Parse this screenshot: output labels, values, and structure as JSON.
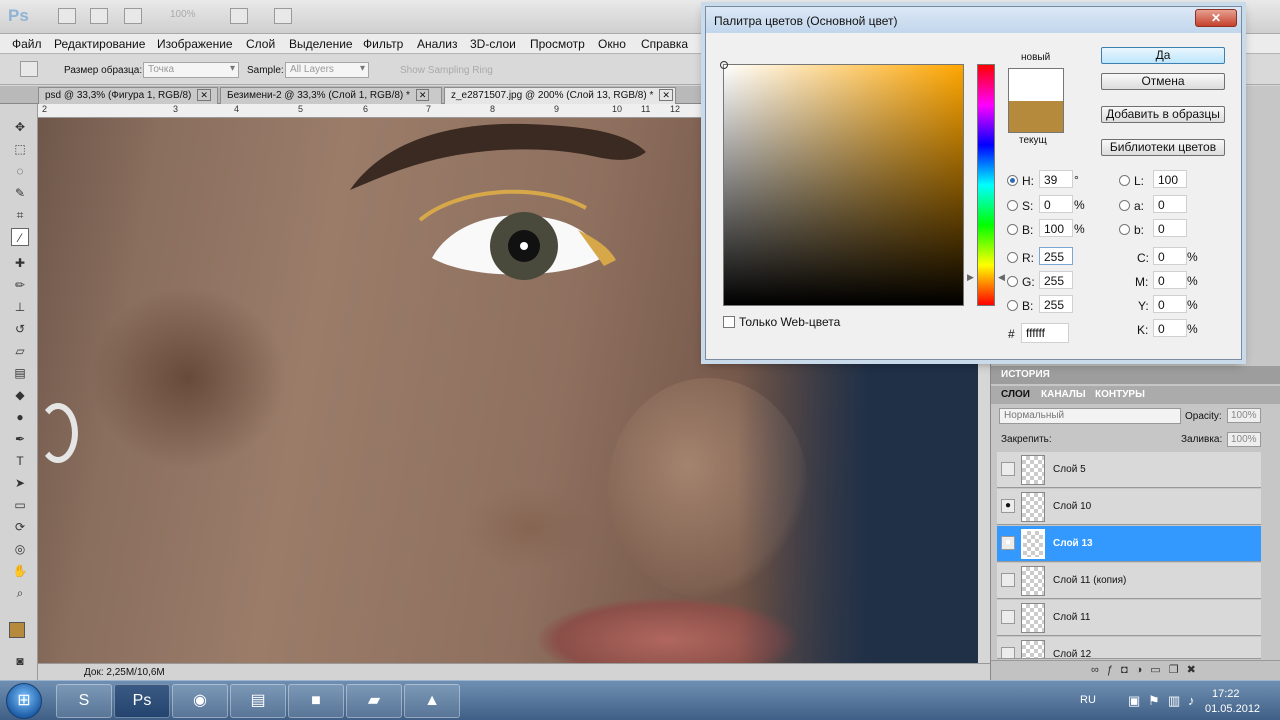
{
  "app": {
    "logo": "Ps",
    "zoom": "100%"
  },
  "menu": [
    "Файл",
    "Редактирование",
    "Изображение",
    "Слой",
    "Выделение",
    "Фильтр",
    "Анализ",
    "3D-слои",
    "Просмотр",
    "Окно",
    "Справка"
  ],
  "options": {
    "sample_size_label": "Размер образца:",
    "sample_size_value": "Точка",
    "sample_label": "Sample:",
    "sample_value": "All Layers",
    "sampling_ring_label": "Show Sampling Ring"
  },
  "doc_tabs": [
    {
      "label": "psd @ 33,3% (Фигура 1, RGB/8)"
    },
    {
      "label": "Безимени-2 @ 33,3% (Слой 1, RGB/8) *"
    },
    {
      "label": "z_e2871507.jpg @ 200% (Слой 13, RGB/8) *"
    }
  ],
  "ruler": [
    "2",
    "3",
    "4",
    "5",
    "6",
    "7",
    "8",
    "9",
    "10",
    "11",
    "12"
  ],
  "status": {
    "doc_size": "Док: 2,25M/10,6M"
  },
  "colors": {
    "foreground": "#b58a3d",
    "new_color": "#ffffff",
    "selection": "#3399ff"
  },
  "dialog": {
    "title": "Палитра цветов (Основной цвет)",
    "close": "✕",
    "label_new": "новый",
    "label_current": "текущ",
    "btn_ok": "Да",
    "btn_cancel": "Отмена",
    "btn_add_swatch": "Добавить в образцы",
    "btn_libraries": "Библиотеки цветов",
    "web_only": "Только Web-цвета",
    "hex_label": "#",
    "hex_value": "ffffff",
    "hsb": [
      {
        "label": "H:",
        "value": "39",
        "unit": "°"
      },
      {
        "label": "S:",
        "value": "0",
        "unit": "%"
      },
      {
        "label": "B:",
        "value": "100",
        "unit": "%"
      }
    ],
    "rgb": [
      {
        "label": "R:",
        "value": "255"
      },
      {
        "label": "G:",
        "value": "255"
      },
      {
        "label": "B:",
        "value": "255"
      }
    ],
    "lab": [
      {
        "label": "L:",
        "value": "100"
      },
      {
        "label": "a:",
        "value": "0"
      },
      {
        "label": "b:",
        "value": "0"
      }
    ],
    "cmyk": [
      {
        "label": "C:",
        "value": "0",
        "unit": "%"
      },
      {
        "label": "M:",
        "value": "0",
        "unit": "%"
      },
      {
        "label": "Y:",
        "value": "0",
        "unit": "%"
      },
      {
        "label": "K:",
        "value": "0",
        "unit": "%"
      }
    ]
  },
  "panels": {
    "history": "ИСТОРИЯ",
    "tabs": [
      "СЛОИ",
      "КАНАЛЫ",
      "КОНТУРЫ"
    ],
    "blend_mode": "Нормальный",
    "opacity_label": "Opacity:",
    "opacity_value": "100%",
    "lock_label": "Закрепить:",
    "fill_label": "Заливка:",
    "fill_value": "100%",
    "layers": [
      {
        "name": "Слой 5",
        "visible": false,
        "selected": false
      },
      {
        "name": "Слой 10",
        "visible": true,
        "selected": false
      },
      {
        "name": "Слой 13",
        "visible": true,
        "selected": true
      },
      {
        "name": "Слой 11 (копия)",
        "visible": false,
        "selected": false
      },
      {
        "name": "Слой 11",
        "visible": false,
        "selected": false
      },
      {
        "name": "Слой 12",
        "visible": false,
        "selected": false
      }
    ]
  },
  "taskbar": {
    "lang": "RU",
    "time": "17:22",
    "date": "01.05.2012"
  }
}
